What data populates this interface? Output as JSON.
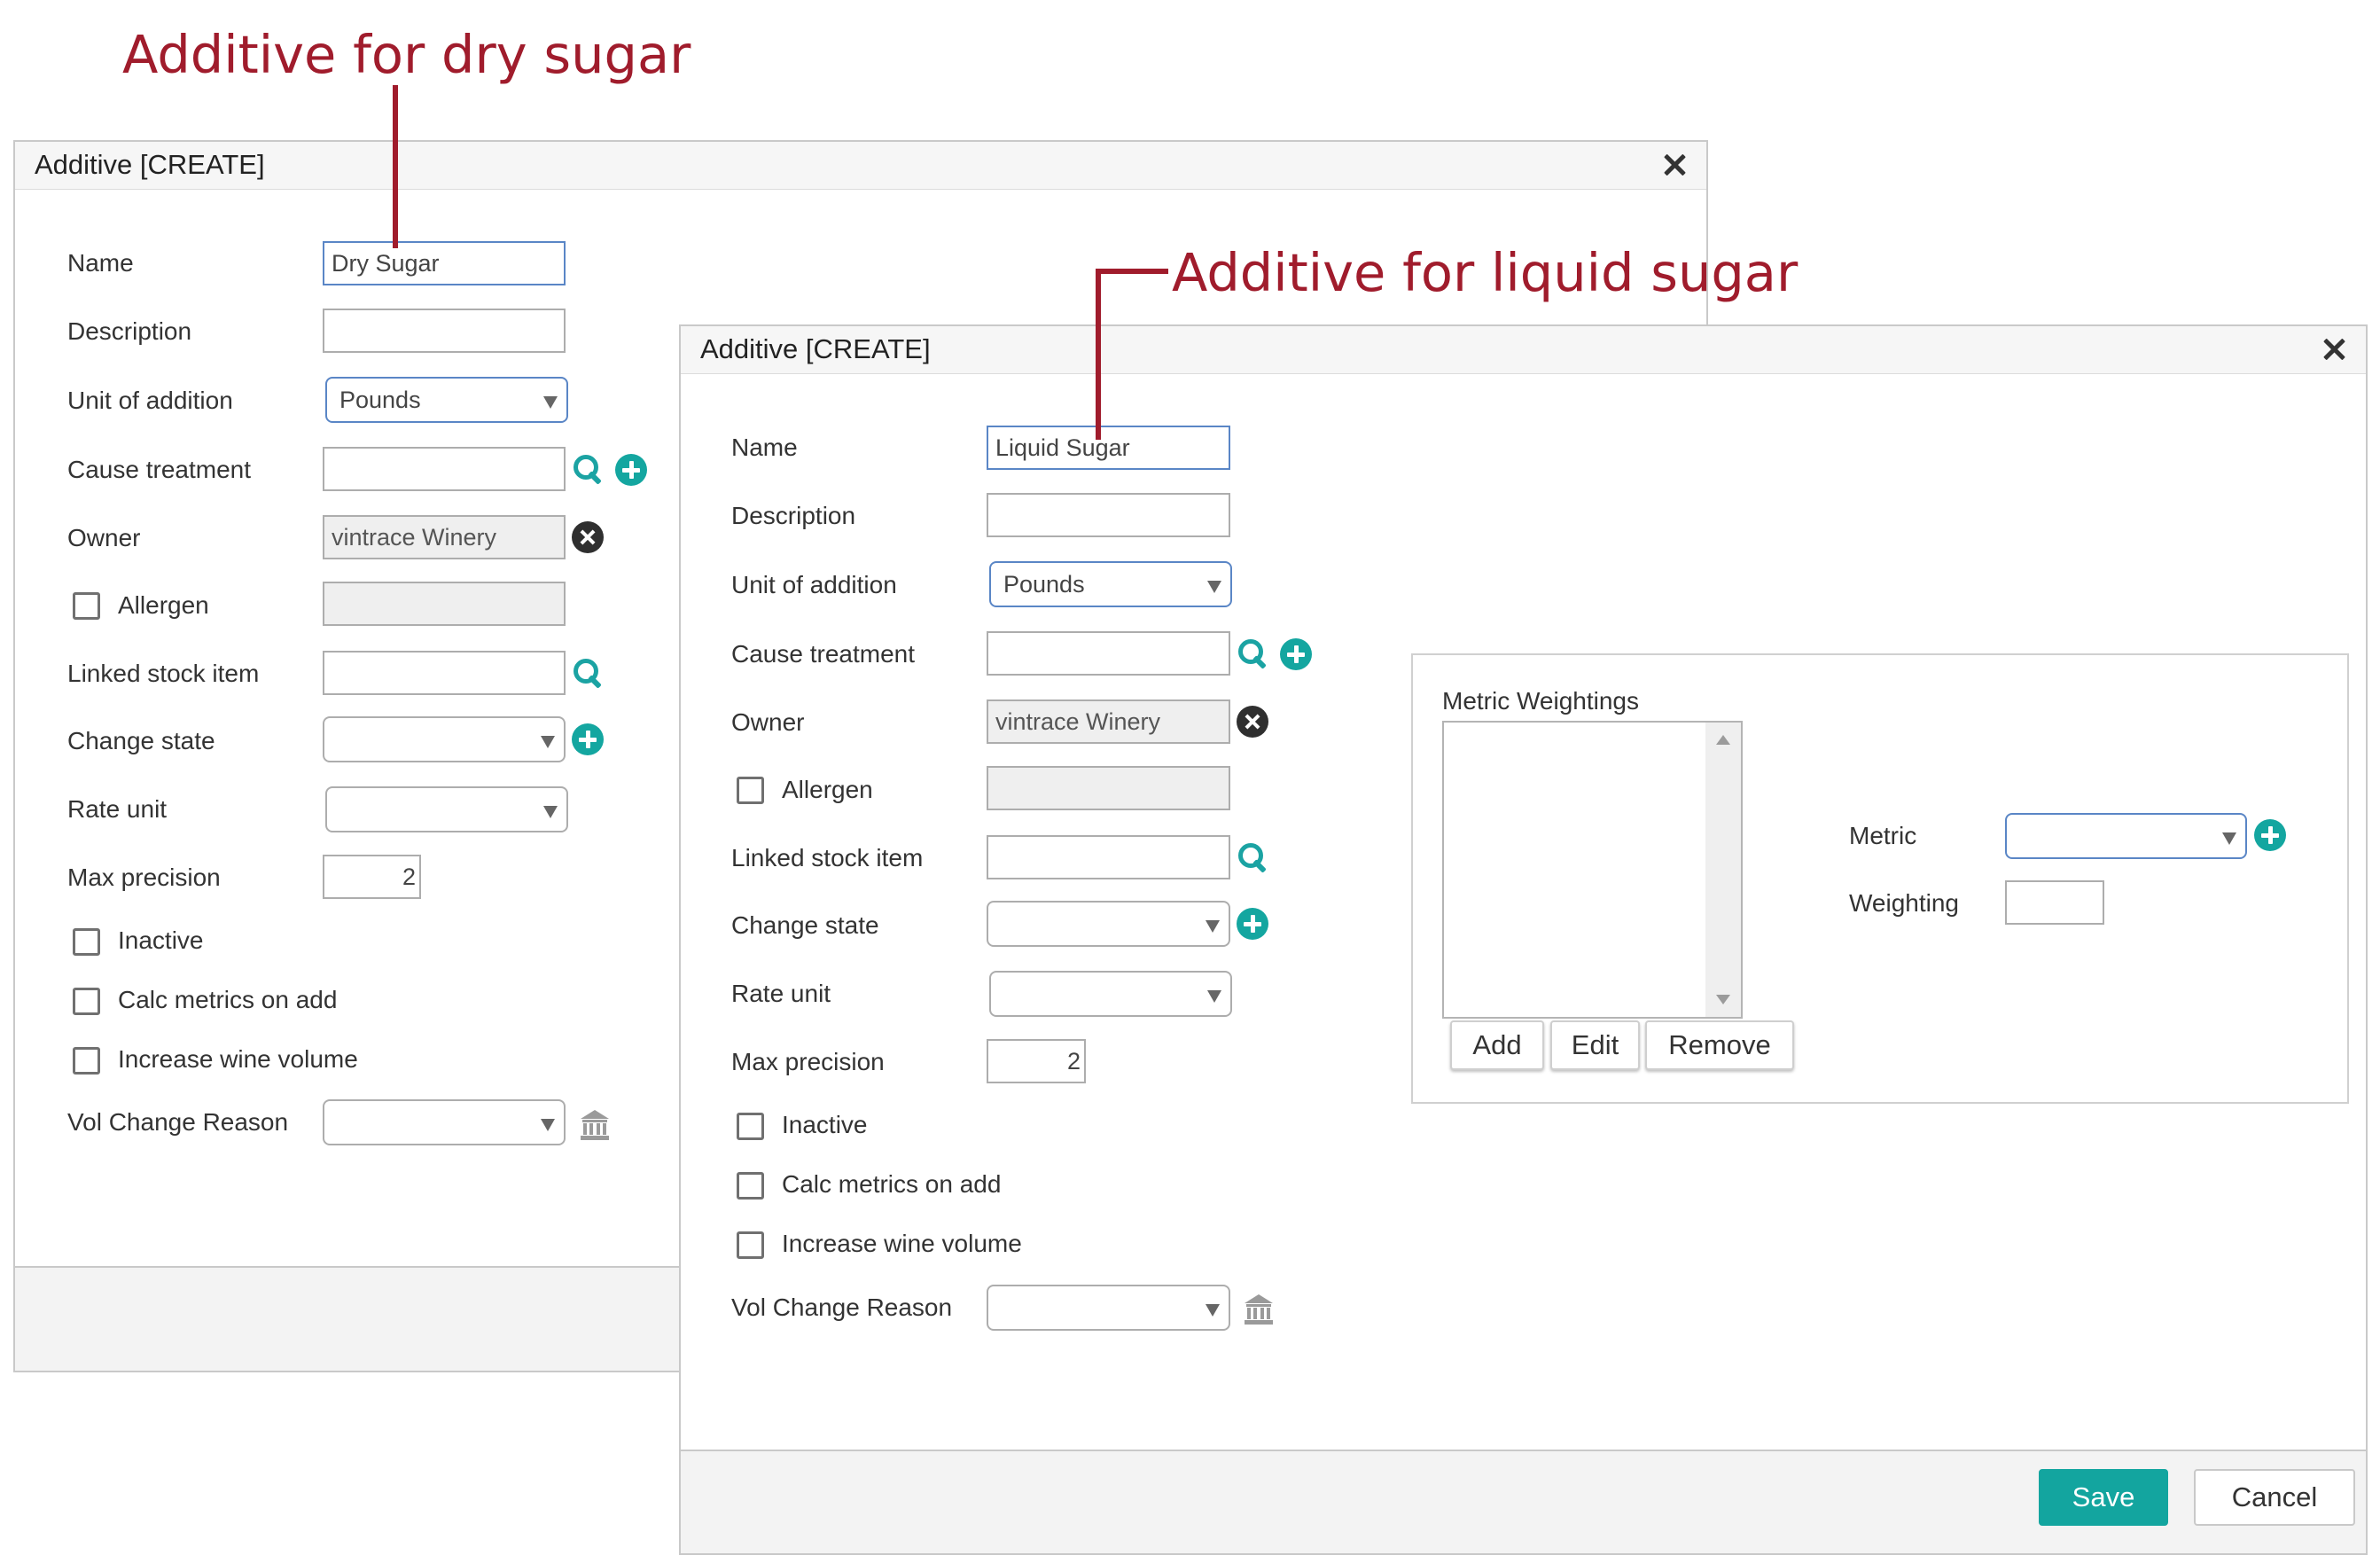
{
  "annotations": {
    "dry": "Additive for dry sugar",
    "liquid": "Additive for liquid sugar"
  },
  "dialog1": {
    "title": "Additive [CREATE]",
    "labels": {
      "name": "Name",
      "description": "Description",
      "unit_of_addition": "Unit of addition",
      "cause_treatment": "Cause treatment",
      "owner": "Owner",
      "allergen": "Allergen",
      "linked_stock_item": "Linked stock item",
      "change_state": "Change state",
      "rate_unit": "Rate unit",
      "max_precision": "Max precision",
      "inactive": "Inactive",
      "calc_metrics_on_add": "Calc metrics on add",
      "increase_wine_volume": "Increase wine volume",
      "vol_change_reason": "Vol Change Reason"
    },
    "values": {
      "name": "Dry Sugar",
      "unit_of_addition": "Pounds",
      "owner": "vintrace Winery",
      "max_precision": "2"
    }
  },
  "dialog2": {
    "title": "Additive [CREATE]",
    "labels": {
      "name": "Name",
      "description": "Description",
      "unit_of_addition": "Unit of addition",
      "cause_treatment": "Cause treatment",
      "owner": "Owner",
      "allergen": "Allergen",
      "linked_stock_item": "Linked stock item",
      "change_state": "Change state",
      "rate_unit": "Rate unit",
      "max_precision": "Max precision",
      "inactive": "Inactive",
      "calc_metrics_on_add": "Calc metrics on add",
      "increase_wine_volume": "Increase wine volume",
      "vol_change_reason": "Vol Change Reason"
    },
    "values": {
      "name": "Liquid Sugar",
      "unit_of_addition": "Pounds",
      "owner": "vintrace Winery",
      "max_precision": "2"
    },
    "metric_weightings": {
      "title": "Metric Weightings",
      "metric_label": "Metric",
      "weighting_label": "Weighting",
      "add_label": "Add",
      "edit_label": "Edit",
      "remove_label": "Remove"
    },
    "footer": {
      "save_label": "Save",
      "cancel_label": "Cancel"
    }
  },
  "colors": {
    "annotation": "#a01c2c",
    "accent": "#13a59f",
    "focus_border": "#5a86c6"
  }
}
